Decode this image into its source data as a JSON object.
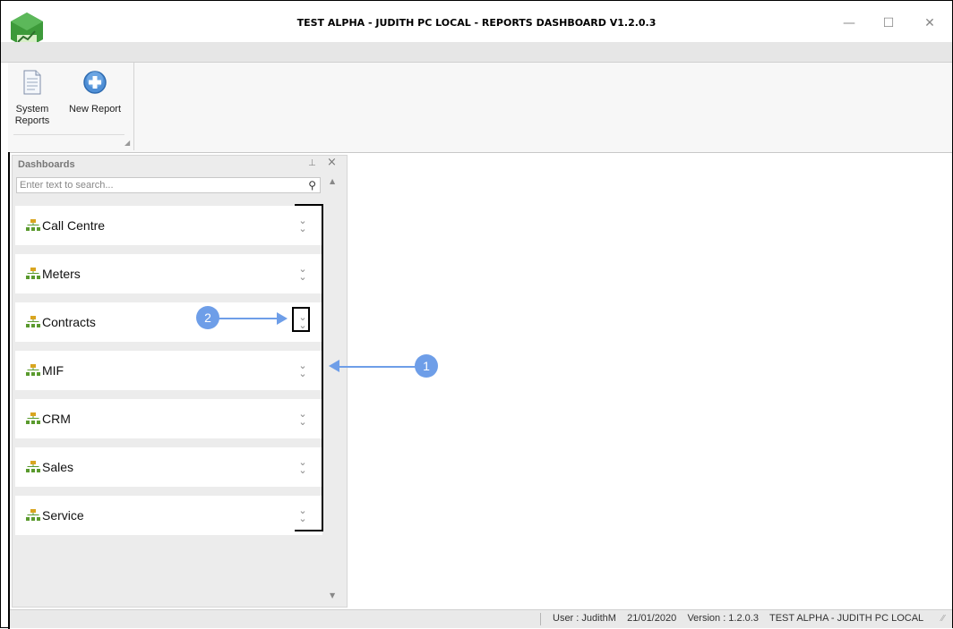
{
  "window": {
    "title": "TEST ALPHA - JUDITH PC LOCAL - REPORTS DASHBOARD V1.2.0.3",
    "minimize_icon": "minimize-icon",
    "maximize_icon": "maximize-icon",
    "close_icon": "close-icon"
  },
  "ribbon": {
    "buttons": [
      {
        "label_line1": "System",
        "label_line2": "Reports",
        "icon": "document-icon"
      },
      {
        "label_line1": "New Report",
        "label_line2": "",
        "icon": "plus-circle-icon"
      }
    ]
  },
  "dashboards_panel": {
    "title": "Dashboards",
    "search_placeholder": "Enter text to search...",
    "items": [
      {
        "label": "Call Centre"
      },
      {
        "label": "Meters"
      },
      {
        "label": "Contracts"
      },
      {
        "label": "MIF"
      },
      {
        "label": "CRM"
      },
      {
        "label": "Sales"
      },
      {
        "label": "Service"
      }
    ]
  },
  "annotations": {
    "callout_1": "1",
    "callout_2": "2",
    "accent_color": "#6e9ee8"
  },
  "statusbar": {
    "user": "User : JudithM",
    "date": "21/01/2020",
    "version": "Version : 1.2.0.3",
    "connection": "TEST ALPHA - JUDITH PC LOCAL"
  }
}
